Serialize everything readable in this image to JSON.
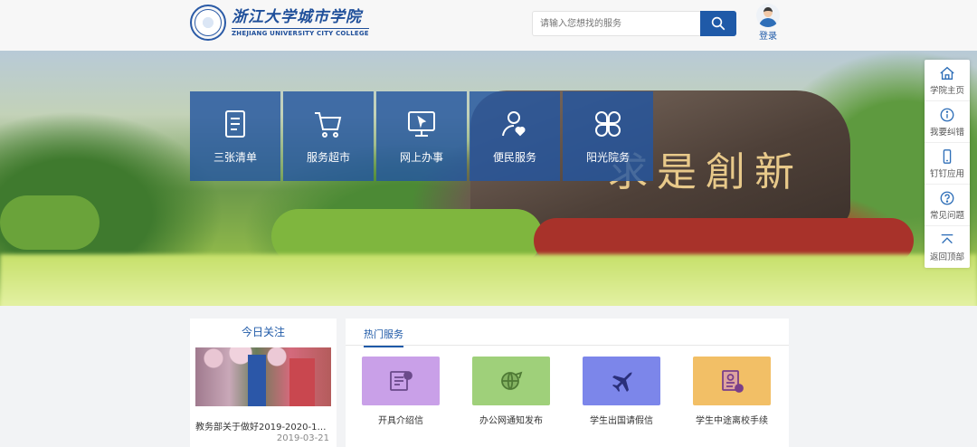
{
  "header": {
    "logo_cn": "浙江大学城市学院",
    "logo_en": "ZHEJIANG UNIVERSITY CITY COLLEGE",
    "search_placeholder": "请输入您想找的服务",
    "login_label": "登录"
  },
  "banner": {
    "stone_text": "求是創新",
    "tiles": [
      {
        "label": "三张清单",
        "icon": "checklist-icon"
      },
      {
        "label": "服务超市",
        "icon": "shopping-cart-icon"
      },
      {
        "label": "网上办事",
        "icon": "monitor-icon"
      },
      {
        "label": "便民服务",
        "icon": "user-heart-icon"
      },
      {
        "label": "阳光院务",
        "icon": "four-leaf-icon"
      }
    ]
  },
  "sidebar": {
    "items": [
      {
        "label": "学院主页",
        "icon": "home-icon"
      },
      {
        "label": "我要纠错",
        "icon": "info-icon"
      },
      {
        "label": "钉钉应用",
        "icon": "phone-icon"
      },
      {
        "label": "常见问题",
        "icon": "question-icon"
      },
      {
        "label": "返回顶部",
        "icon": "back-to-top-icon"
      }
    ]
  },
  "today": {
    "title": "今日关注",
    "news_title": "教务部关于做好2019-2020-1学...",
    "news_date": "2019-03-21"
  },
  "hot_services": {
    "tab_label": "热门服务",
    "items": [
      {
        "label": "开具介绍信",
        "icon": "certificate-icon",
        "color": "#c9a0e8"
      },
      {
        "label": "办公网通知发布",
        "icon": "globe-send-icon",
        "color": "#9fd07a"
      },
      {
        "label": "学生出国请假信",
        "icon": "airplane-icon",
        "color": "#7c86ea"
      },
      {
        "label": "学生中途离校手续",
        "icon": "document-badge-icon",
        "color": "#f2bf66"
      }
    ]
  },
  "colors": {
    "brand_blue": "#1f5aa8",
    "tile_blue": "#2356a0"
  }
}
